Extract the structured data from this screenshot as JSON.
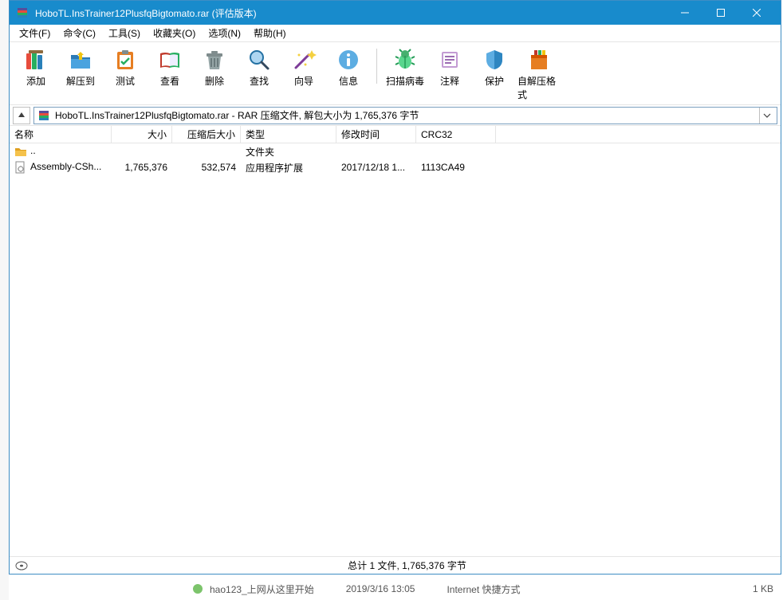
{
  "titlebar": {
    "title": "HoboTL.InsTrainer12PlusfqBigtomato.rar (评估版本)"
  },
  "menu": {
    "file": "文件(F)",
    "command": "命令(C)",
    "tools": "工具(S)",
    "favorites": "收藏夹(O)",
    "options": "选项(N)",
    "help": "帮助(H)"
  },
  "toolbar": {
    "add": "添加",
    "extract_to": "解压到",
    "test": "测试",
    "view": "查看",
    "delete": "删除",
    "find": "查找",
    "wizard": "向导",
    "info": "信息",
    "virus_scan": "扫描病毒",
    "comment": "注释",
    "protect": "保护",
    "sfx": "自解压格式"
  },
  "addressbar": {
    "text": "HoboTL.InsTrainer12PlusfqBigtomato.rar - RAR 压缩文件, 解包大小为 1,765,376 字节"
  },
  "columns": {
    "name": "名称",
    "size": "大小",
    "packed": "压缩后大小",
    "type": "类型",
    "mtime": "修改时间",
    "crc": "CRC32"
  },
  "rows": {
    "up": {
      "name": "..",
      "type": "文件夹"
    },
    "r0": {
      "name": "Assembly-CSh...",
      "size": "1,765,376",
      "packed": "532,574",
      "type": "应用程序扩展",
      "mtime": "2017/12/18 1...",
      "crc": "1113CA49"
    }
  },
  "statusbar": {
    "summary": "总计 1 文件, 1,765,376 字节"
  },
  "taskbar": {
    "item1_name": "hao123_上网从这里开始",
    "item1_date": "2019/3/16 13:05",
    "item1_type": "Internet 快捷方式",
    "item1_size": "1 KB"
  }
}
